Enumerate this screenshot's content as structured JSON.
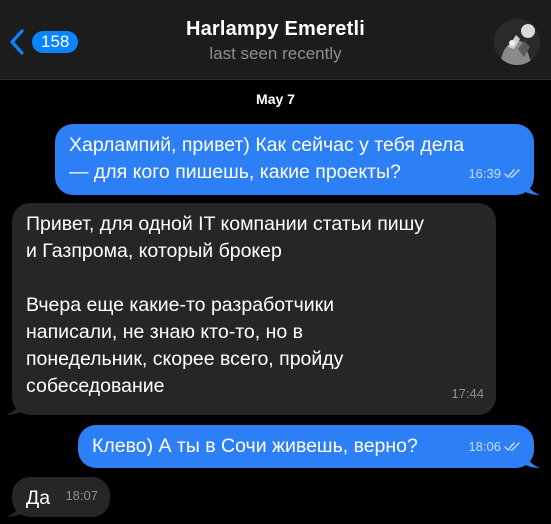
{
  "header": {
    "back_badge": "158",
    "contact_name": "Harlampy Emeretli",
    "status": "last seen recently"
  },
  "date_separator": "May 7",
  "messages": [
    {
      "direction": "outgoing",
      "lines": [
        "Харлампий, привет) Как сейчас у тебя дела",
        "— для кого пишешь, какие проекты?"
      ],
      "time": "16:39",
      "read": true
    },
    {
      "direction": "incoming",
      "para1": [
        "Привет, для одной IT компании статьи пишу",
        "и Газпрома, который брокер"
      ],
      "para2": [
        "Вчера еще какие-то разработчики",
        "написали, не знаю кто-то, но в",
        "понедельник, скорее всего, пройду",
        "собеседование"
      ],
      "time": "17:44"
    },
    {
      "direction": "outgoing",
      "text": "Клево) А ты в Сочи живешь, верно?",
      "time": "18:06",
      "read": true
    },
    {
      "direction": "incoming",
      "text": "Да",
      "time": "18:07"
    }
  ],
  "colors": {
    "background": "#000000",
    "header": "#1c1c1d",
    "outgoing_bubble": "#2d7ff6",
    "incoming_bubble": "#262628",
    "accent": "#0a84ff"
  }
}
